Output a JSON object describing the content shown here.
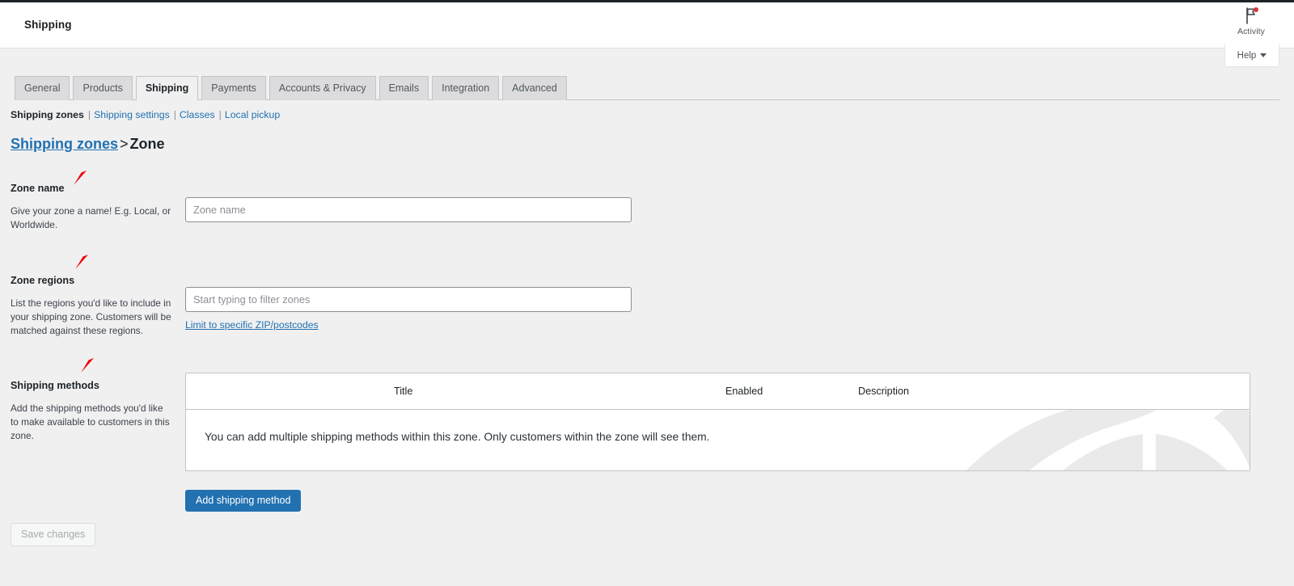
{
  "header": {
    "title": "Shipping",
    "activity_label": "Activity",
    "activity_icon": "flag-icon",
    "has_activity_badge": true,
    "help_label": "Help",
    "help_caret_icon": "chevron-down-icon"
  },
  "tabs": [
    {
      "label": "General",
      "active": false
    },
    {
      "label": "Products",
      "active": false
    },
    {
      "label": "Shipping",
      "active": true
    },
    {
      "label": "Payments",
      "active": false
    },
    {
      "label": "Accounts & Privacy",
      "active": false
    },
    {
      "label": "Emails",
      "active": false
    },
    {
      "label": "Integration",
      "active": false
    },
    {
      "label": "Advanced",
      "active": false
    }
  ],
  "subnav": {
    "items": [
      {
        "label": "Shipping zones",
        "current": true
      },
      {
        "label": "Shipping settings",
        "current": false
      },
      {
        "label": "Classes",
        "current": false
      },
      {
        "label": "Local pickup",
        "current": false
      }
    ],
    "separator": "|"
  },
  "breadcrumb": {
    "link": "Shipping zones",
    "separator": ">",
    "current": "Zone"
  },
  "form": {
    "zone_name": {
      "label": "Zone name",
      "description": "Give your zone a name! E.g. Local, or Worldwide.",
      "placeholder": "Zone name",
      "value": ""
    },
    "zone_regions": {
      "label": "Zone regions",
      "description": "List the regions you'd like to include in your shipping zone. Customers will be matched against these regions.",
      "placeholder": "Start typing to filter zones",
      "value": "",
      "zip_link": "Limit to specific ZIP/postcodes"
    },
    "shipping_methods": {
      "label": "Shipping methods",
      "description": "Add the shipping methods you'd like to make available to customers in this zone."
    }
  },
  "table": {
    "columns": [
      "Title",
      "Enabled",
      "Description"
    ],
    "empty_message": "You can add multiple shipping methods within this zone. Only customers within the zone will see them.",
    "watermark_icon": "woocommerce-logo-watermark"
  },
  "buttons": {
    "add_shipping_method": "Add shipping method",
    "save_changes": "Save changes",
    "save_changes_disabled": true
  },
  "colors": {
    "accent": "#2271b1",
    "page_bg": "#f0f0f1",
    "badge_red": "#d63638",
    "marker_red": "#ee0000",
    "border": "#c3c4c7"
  },
  "markers": {
    "icon": "red-arrow-marker",
    "count": 3
  }
}
